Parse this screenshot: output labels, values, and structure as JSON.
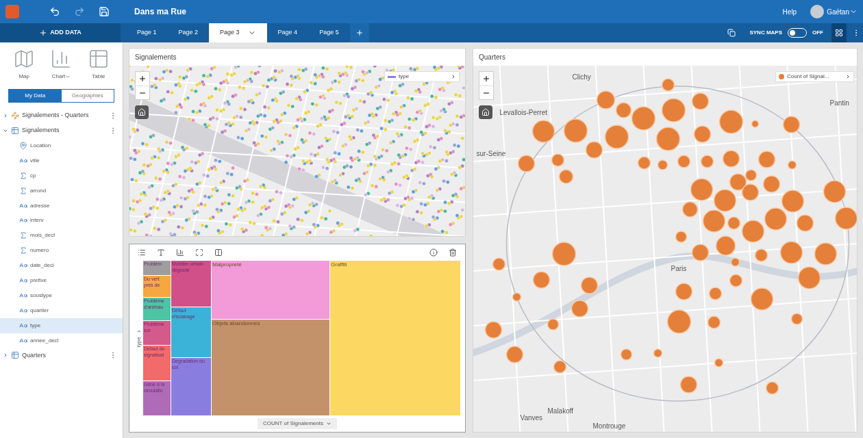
{
  "app": {
    "title": "Dans ma Rue",
    "help": "Help",
    "user": "Gaëtan"
  },
  "add_data": "ADD DATA",
  "pages": [
    {
      "label": "Page 1",
      "selected": false
    },
    {
      "label": "Page 2",
      "selected": false
    },
    {
      "label": "Page 3",
      "selected": true
    },
    {
      "label": "Page 4",
      "selected": false
    },
    {
      "label": "Page 5",
      "selected": false
    }
  ],
  "sync_maps": {
    "label": "SYNC MAPS",
    "on": false,
    "state": "OFF"
  },
  "create": [
    {
      "label": "Map",
      "kind": "map"
    },
    {
      "label": "Chart",
      "kind": "chart"
    },
    {
      "label": "Table",
      "kind": "table"
    }
  ],
  "data_tabs": [
    {
      "label": "My Data",
      "selected": true
    },
    {
      "label": "Geographies",
      "selected": false
    }
  ],
  "datasets": [
    {
      "name": "Signalements - Quarters",
      "kind": "relationship",
      "expanded": false
    },
    {
      "name": "Signalements",
      "kind": "table",
      "expanded": true,
      "children": [
        {
          "name": "Location",
          "kind": "location",
          "selected": false
        },
        {
          "name": "ville",
          "kind": "string",
          "selected": false
        },
        {
          "name": "cp",
          "kind": "number",
          "selected": false
        },
        {
          "name": "arrond",
          "kind": "number",
          "selected": false
        },
        {
          "name": "adresse",
          "kind": "string",
          "selected": false
        },
        {
          "name": "interv",
          "kind": "string",
          "selected": false
        },
        {
          "name": "mois_decl",
          "kind": "number",
          "selected": false
        },
        {
          "name": "numero",
          "kind": "number",
          "selected": false
        },
        {
          "name": "date_decl",
          "kind": "string",
          "selected": false
        },
        {
          "name": "prefixe",
          "kind": "string",
          "selected": false
        },
        {
          "name": "soustype",
          "kind": "string",
          "selected": false
        },
        {
          "name": "quartier",
          "kind": "string",
          "selected": false
        },
        {
          "name": "type",
          "kind": "string",
          "selected": true
        },
        {
          "name": "annee_decl",
          "kind": "string",
          "selected": false
        }
      ]
    },
    {
      "name": "Quarters",
      "kind": "table",
      "expanded": false
    }
  ],
  "signalements_map": {
    "title": "Signalements",
    "legend": "type"
  },
  "treemap": {
    "axis_label": "type",
    "measure": "COUNT of Signalements",
    "columns": [
      {
        "tiles": [
          {
            "label": "Problèm",
            "color": "#9e9e9e"
          },
          {
            "label": "Du vert près de",
            "color": "#f5a742"
          },
          {
            "label": "Problème d'animau",
            "color": "#4dc4a4"
          },
          {
            "label": "Problème sur",
            "color": "#d45a8c"
          },
          {
            "label": "Défaut de signalisat",
            "color": "#f26b6b"
          },
          {
            "label": "Gêne à la circulatio",
            "color": "#b06bb8"
          }
        ]
      },
      {
        "tiles": [
          {
            "label": "Mobilier urbain dégradé",
            "color": "#d2508a"
          },
          {
            "label": "Défaut d'éclairage",
            "color": "#3bb3d8"
          },
          {
            "label": "Dégradation du sol",
            "color": "#8a7de0"
          }
        ]
      },
      {
        "tiles": [
          {
            "label": "Malpropreté",
            "color": "#f39ad8"
          },
          {
            "label": "Objets abandonnés",
            "color": "#c4926a"
          }
        ]
      },
      {
        "tiles": [
          {
            "label": "Graffiti",
            "color": "#fcd862"
          }
        ]
      }
    ]
  },
  "quarters_map": {
    "title": "Quarters",
    "legend": "Count of Signal...",
    "places": [
      {
        "name": "Clichy"
      },
      {
        "name": "Levallois-Perret"
      },
      {
        "name": "Pantin"
      },
      {
        "name": "sur-Seine"
      },
      {
        "name": "Paris"
      },
      {
        "name": "Vanves"
      },
      {
        "name": "Malakoff"
      },
      {
        "name": "Montrouge"
      }
    ]
  }
}
